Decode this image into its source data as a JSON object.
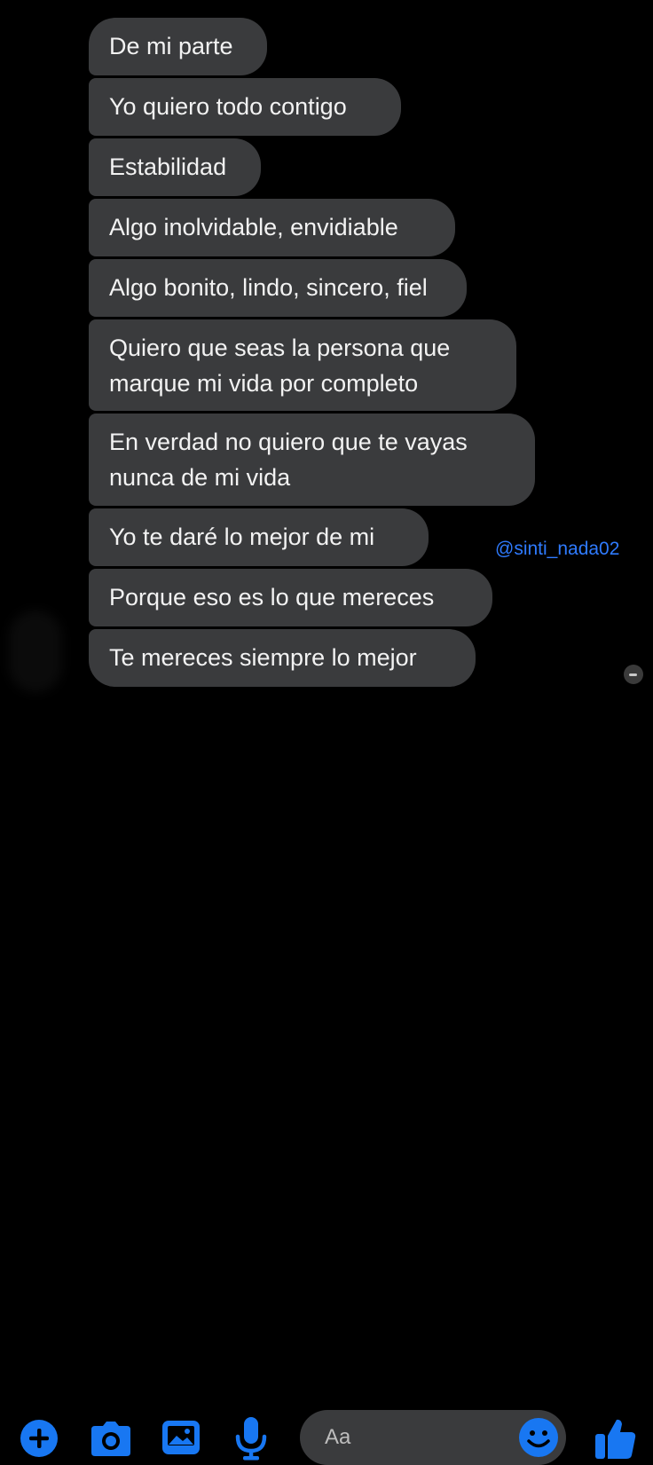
{
  "messages": [
    {
      "text": "De mi parte"
    },
    {
      "text": "Yo quiero todo contigo"
    },
    {
      "text": "Estabilidad"
    },
    {
      "text": "Algo inolvidable, envidiable"
    },
    {
      "text": "Algo bonito, lindo, sincero, fiel"
    },
    {
      "text": "Quiero que seas la persona que\nmarque mi vida por completo"
    },
    {
      "text": "En verdad no quiero que te vayas\nnunca de mi vida"
    },
    {
      "text": "Yo te daré lo mejor de mi"
    },
    {
      "text": "Porque eso es lo que mereces"
    },
    {
      "text": "Te mereces siempre lo mejor"
    }
  ],
  "watermark": "@sinti_nada02",
  "composer": {
    "placeholder": "Aa",
    "icons": [
      "plus-icon",
      "camera-icon",
      "image-icon",
      "microphone-icon",
      "emoji-icon",
      "thumbs-up-icon"
    ],
    "accent_color": "#1877f2"
  },
  "colors": {
    "background": "#000000",
    "bubble": "#3a3b3d",
    "bubble_text": "#f2f2f2",
    "watermark": "#2f7bff"
  }
}
